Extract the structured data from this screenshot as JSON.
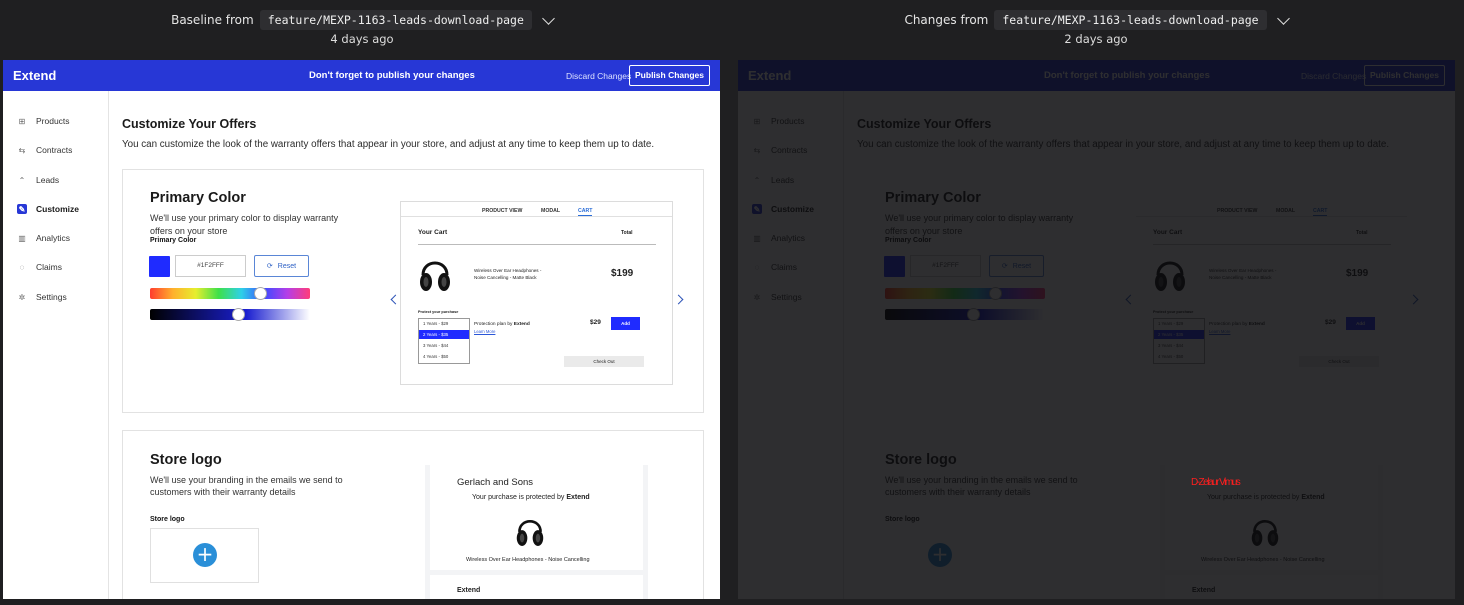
{
  "header_left": {
    "prefix": "Baseline from",
    "branch": "feature/MEXP-1163-leads-download-page",
    "time": "4 days ago"
  },
  "header_right": {
    "prefix": "Changes from",
    "branch": "feature/MEXP-1163-leads-download-page",
    "time": "2 days ago"
  },
  "app": {
    "brand": "Extend",
    "notice": "Don't forget to publish your changes",
    "discard": "Discard Changes",
    "publish": "Publish Changes",
    "nav": [
      {
        "label": "Products",
        "icon": "grid-icon"
      },
      {
        "label": "Contracts",
        "icon": "contract-icon"
      },
      {
        "label": "Leads",
        "icon": "leads-icon"
      },
      {
        "label": "Customize",
        "icon": "customize-icon"
      },
      {
        "label": "Analytics",
        "icon": "analytics-icon"
      },
      {
        "label": "Claims",
        "icon": "claims-icon"
      },
      {
        "label": "Settings",
        "icon": "settings-icon"
      }
    ],
    "title": "Customize Your Offers",
    "description": "You can customize the look of the warranty offers that appear in your store, and adjust at any time to keep them up to date.",
    "primary": {
      "heading": "Primary Color",
      "text1": "We'll use your primary color to display warranty",
      "text2": "offers on your store",
      "label": "Primary Color",
      "hex": "#1F2FFF",
      "reset": "Reset",
      "swatch": "#1f2bff",
      "hue_level": 0.69,
      "sat_level": 0.55
    },
    "preview": {
      "tabs": [
        "PRODUCT VIEW",
        "MODAL",
        "CART"
      ],
      "cart_title": "Your Cart",
      "total": "Total",
      "product_line1": "Wireless Over Ear Headphones -",
      "product_line2": "Noise Cancelling - Matte Black",
      "price": "$199",
      "protect": "Protect your purchase",
      "plan_text": "Protection plan by",
      "plan_brand": "Extend",
      "learn": "Learn More",
      "plan_price": "$29",
      "add": "Add",
      "options": [
        "1 Years - $29",
        "2 Years - $35",
        "3 Years - $44",
        "4 Years - $50"
      ],
      "checkout": "Check Out"
    },
    "logo": {
      "heading": "Store logo",
      "text1": "We'll use your branding in the emails we send to",
      "text2": "customers with their warranty details",
      "label": "Store logo",
      "store": "Gerlach and Sons",
      "protected": "Your purchase is protected by",
      "protected_brand": "Extend",
      "product": "Wireless Over Ear Headphones - Noise Cancelling",
      "footer_brand": "Extend",
      "changed_store": "D-Zelaur Vimus"
    }
  }
}
